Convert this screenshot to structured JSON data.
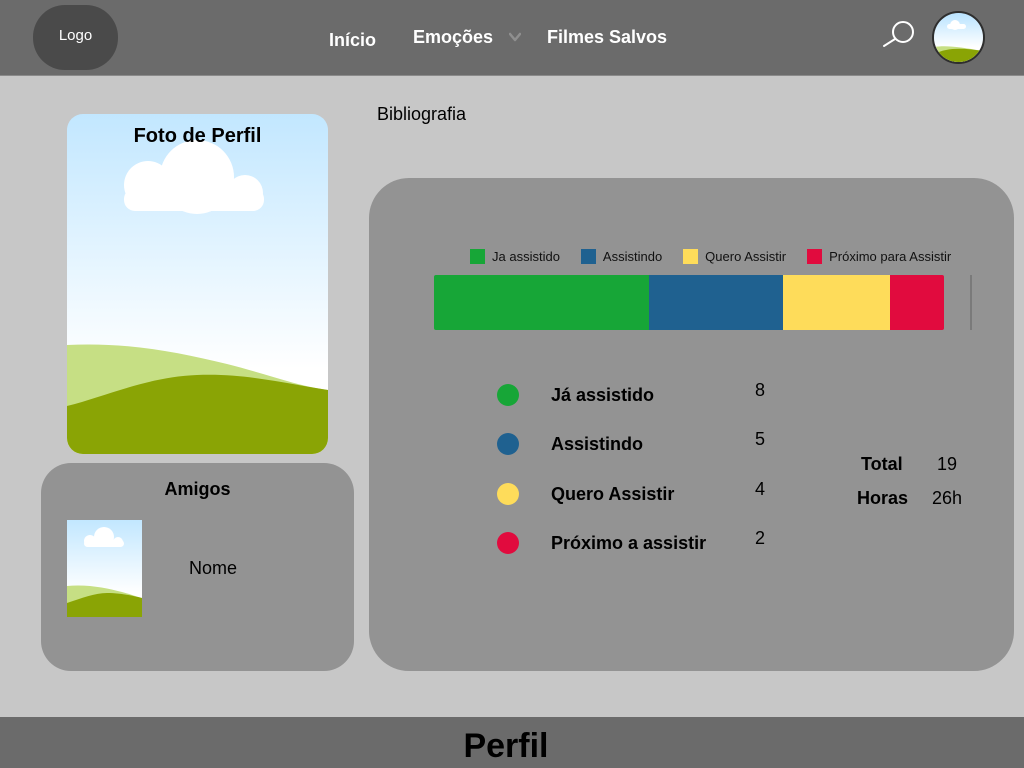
{
  "header": {
    "logo_label": "Logo",
    "nav": [
      {
        "label": "Início"
      },
      {
        "label": "Emoções"
      },
      {
        "label": "Filmes Salvos"
      }
    ]
  },
  "profile": {
    "photo_label": "Foto de Perfil"
  },
  "friends": {
    "title": "Amigos",
    "items": [
      {
        "name": "Nome"
      }
    ]
  },
  "bibliography": {
    "heading": "Bibliografia"
  },
  "chart_data": {
    "type": "bar",
    "orientation": "horizontal-stacked",
    "series": [
      {
        "name": "Ja assistido",
        "values": [
          8
        ],
        "color": "#17a637"
      },
      {
        "name": "Assistindo",
        "values": [
          5
        ],
        "color": "#1f6190"
      },
      {
        "name": "Quero Assistir",
        "values": [
          4
        ],
        "color": "#fedc5a"
      },
      {
        "name": "Próximo para Assistir",
        "values": [
          2
        ],
        "color": "#e10b3e"
      }
    ],
    "legend_position": "top",
    "grid": false
  },
  "stats": {
    "rows": [
      {
        "label": "Já assistido",
        "value": "8",
        "color": "#17a637"
      },
      {
        "label": "Assistindo",
        "value": "5",
        "color": "#1f6190"
      },
      {
        "label": "Quero Assistir",
        "value": "4",
        "color": "#fedc5a"
      },
      {
        "label": "Próximo a assistir",
        "value": "2",
        "color": "#e10b3e"
      }
    ],
    "total_label": "Total",
    "total_value": "19",
    "hours_label": "Horas",
    "hours_value": "26h"
  },
  "footer": {
    "title": "Perfil"
  }
}
